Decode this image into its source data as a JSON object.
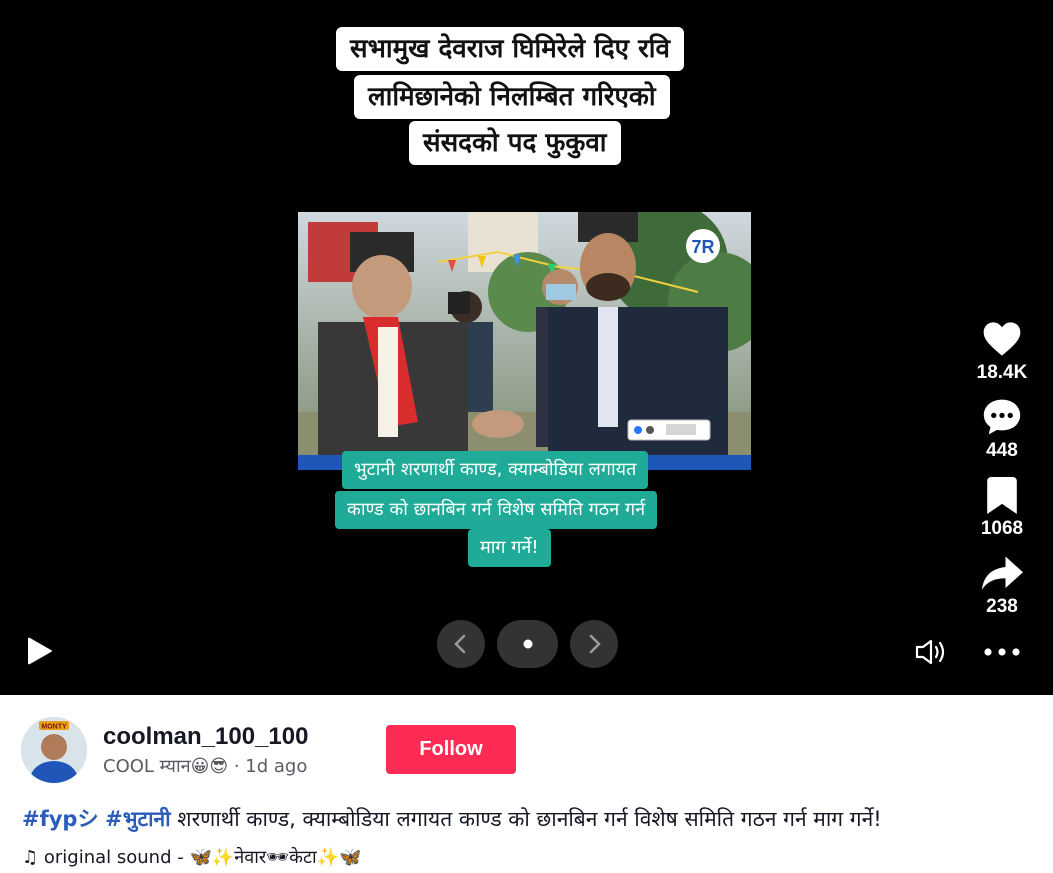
{
  "video": {
    "title_lines": [
      "सभामुख देवराज घिमिरेले दिए रवि",
      "लामिछानेको निलम्बित गरिएको",
      "संसदको पद फुकुवा"
    ],
    "caption_lines": [
      "भुटानी शरणार्थी काण्ड, क्याम्बोडिया लगायत",
      "काण्ड को छानबिन गर्न विशेष समिति गठन गर्न",
      "माग गर्ने!"
    ],
    "photo_logo": "7R"
  },
  "actions": {
    "likes": "18.4K",
    "comments": "448",
    "saves": "1068",
    "shares": "238"
  },
  "controls": {
    "play_icon": "play-icon",
    "volume_icon": "volume-icon",
    "more_icon": "more-icon"
  },
  "author": {
    "username": "coolman_100_100",
    "display_name": "COOL म्यान😀😎",
    "time": " · 1d ago",
    "follow_label": "Follow",
    "avatar_badge": "MONTY"
  },
  "description": {
    "tag1": "#fypシ",
    "tag2": "#भुटानी",
    "text": " शरणार्थी काण्ड, क्याम्बोडिया लगायत काण्ड को छानबिन गर्न विशेष समिति गठन गर्न माग गर्ने!"
  },
  "sound": {
    "icon": "♫",
    "label": "original sound - 🦋✨नेवार🕶केटा✨🦋"
  },
  "colors": {
    "follow": "#fe2c55",
    "caption_bg": "#1fab98",
    "hashtag": "#2b5db9"
  }
}
